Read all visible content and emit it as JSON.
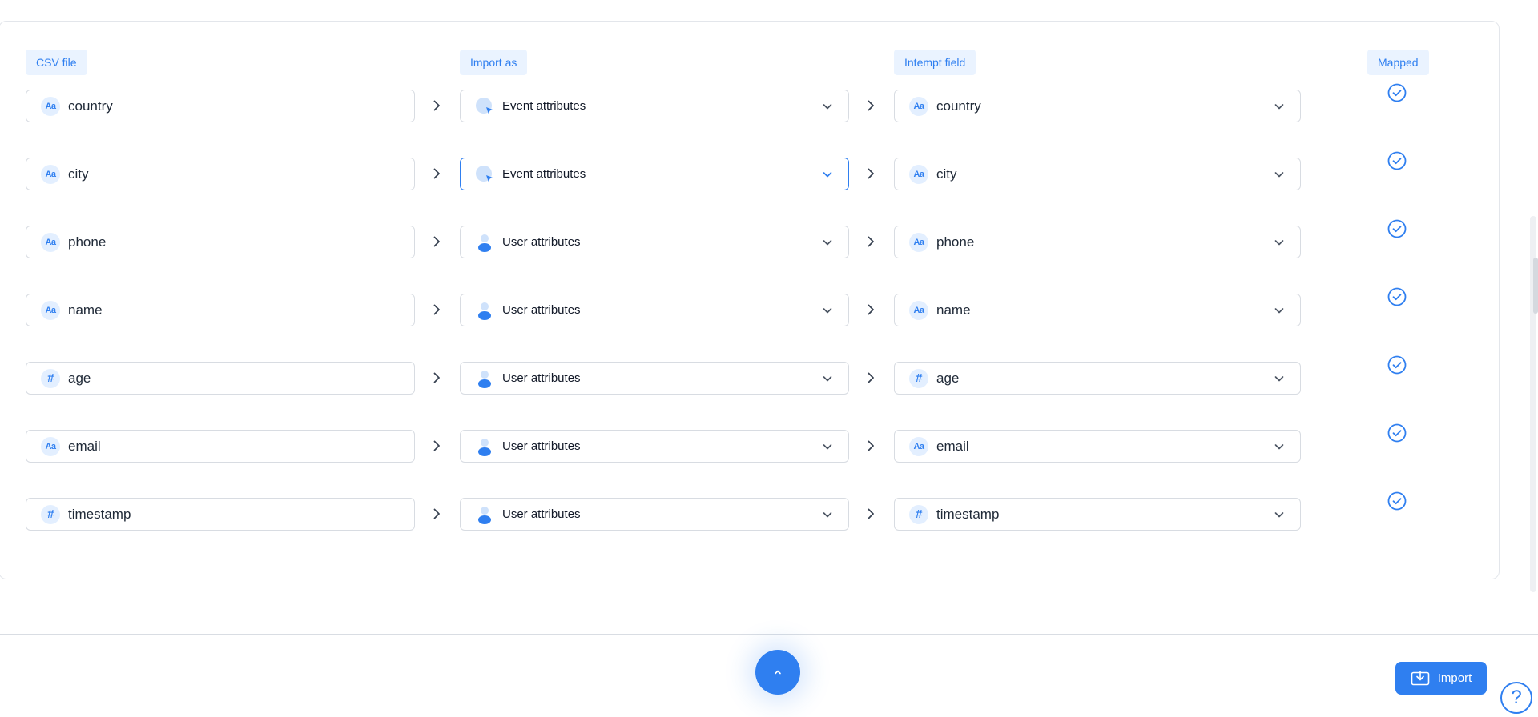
{
  "headers": {
    "csv_file": "CSV file",
    "import_as": "Import as",
    "intempt_field": "Intempt field",
    "mapped": "Mapped"
  },
  "rows": [
    {
      "csv_field": "country",
      "csv_type": "text",
      "import_as": "Event attributes",
      "category": "event",
      "target_field": "country",
      "target_type": "text",
      "mapped": true,
      "active": false
    },
    {
      "csv_field": "city",
      "csv_type": "text",
      "import_as": "Event attributes",
      "category": "event",
      "target_field": "city",
      "target_type": "text",
      "mapped": true,
      "active": true
    },
    {
      "csv_field": "phone",
      "csv_type": "text",
      "import_as": "User attributes",
      "category": "user",
      "target_field": "phone",
      "target_type": "text",
      "mapped": true,
      "active": false
    },
    {
      "csv_field": "name",
      "csv_type": "text",
      "import_as": "User attributes",
      "category": "user",
      "target_field": "name",
      "target_type": "text",
      "mapped": true,
      "active": false
    },
    {
      "csv_field": "age",
      "csv_type": "number",
      "import_as": "User attributes",
      "category": "user",
      "target_field": "age",
      "target_type": "number",
      "mapped": true,
      "active": false
    },
    {
      "csv_field": "email",
      "csv_type": "text",
      "import_as": "User attributes",
      "category": "user",
      "target_field": "email",
      "target_type": "text",
      "mapped": true,
      "active": false
    },
    {
      "csv_field": "timestamp",
      "csv_type": "number",
      "import_as": "User attributes",
      "category": "user",
      "target_field": "timestamp",
      "target_type": "number",
      "mapped": true,
      "active": false
    }
  ],
  "type_icons": {
    "text": "Aa",
    "number": "#"
  },
  "footer": {
    "import_label": "Import",
    "help_label": "?"
  },
  "colors": {
    "accent": "#2f7ff0",
    "accent_light": "#e3efff"
  }
}
